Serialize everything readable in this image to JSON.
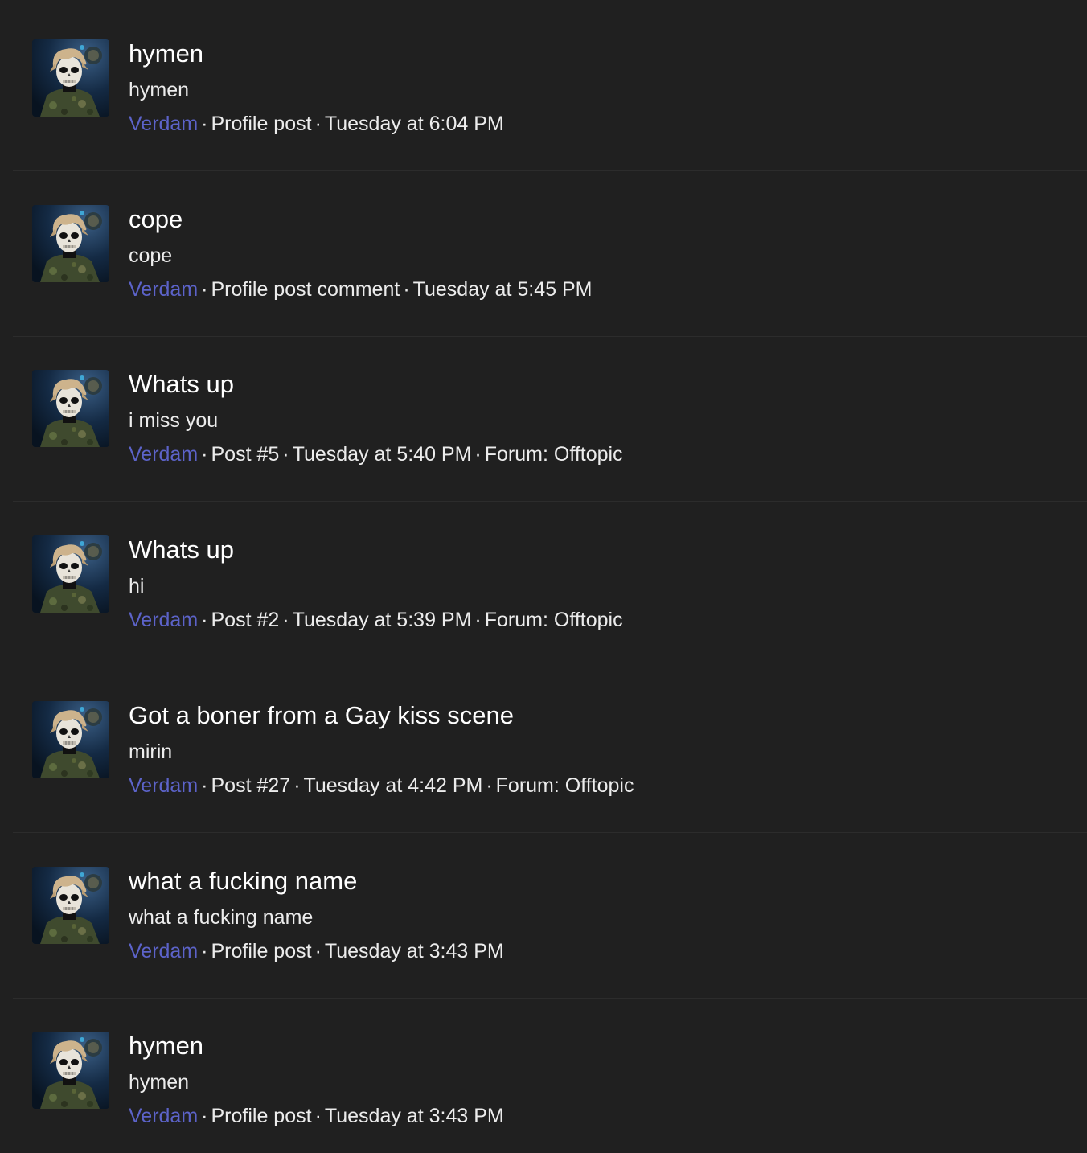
{
  "colors": {
    "background": "#202020",
    "divider": "#2c2c2c",
    "username_link": "#5c63c9",
    "text": "#ececec"
  },
  "avatar_icon": "skull-face-anime-avatar",
  "separator": "·",
  "items": [
    {
      "title": "hymen",
      "snippet": "hymen",
      "user": "Verdam",
      "type": "Profile post",
      "time": "Tuesday at 6:04 PM",
      "forum_label": "",
      "forum": ""
    },
    {
      "title": "cope",
      "snippet": "cope",
      "user": "Verdam",
      "type": "Profile post comment",
      "time": "Tuesday at 5:45 PM",
      "forum_label": "",
      "forum": ""
    },
    {
      "title": "Whats up",
      "snippet": "i miss you",
      "user": "Verdam",
      "type": "Post #5",
      "time": "Tuesday at 5:40 PM",
      "forum_label": "Forum:",
      "forum": "Offtopic"
    },
    {
      "title": "Whats up",
      "snippet": "hi",
      "user": "Verdam",
      "type": "Post #2",
      "time": "Tuesday at 5:39 PM",
      "forum_label": "Forum:",
      "forum": "Offtopic"
    },
    {
      "title": "Got a boner from a Gay kiss scene",
      "snippet": "mirin",
      "user": "Verdam",
      "type": "Post #27",
      "time": "Tuesday at 4:42 PM",
      "forum_label": "Forum:",
      "forum": "Offtopic"
    },
    {
      "title": "what a fucking name",
      "snippet": "what a fucking name",
      "user": "Verdam",
      "type": "Profile post",
      "time": "Tuesday at 3:43 PM",
      "forum_label": "",
      "forum": ""
    },
    {
      "title": "hymen",
      "snippet": "hymen",
      "user": "Verdam",
      "type": "Profile post",
      "time": "Tuesday at 3:43 PM",
      "forum_label": "",
      "forum": ""
    }
  ]
}
